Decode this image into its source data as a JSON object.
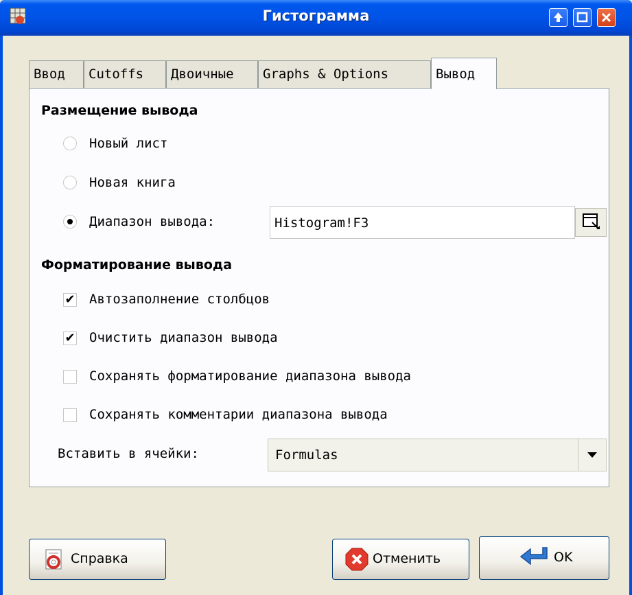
{
  "window": {
    "title": "Гистограмма"
  },
  "tabs": [
    {
      "label": "Ввод"
    },
    {
      "label": "Cutoffs"
    },
    {
      "label": "Двоичные"
    },
    {
      "label": "Graphs & Options"
    },
    {
      "label": "Вывод"
    }
  ],
  "output_location": {
    "heading": "Размещение вывода",
    "new_sheet": "Новый лист",
    "new_workbook": "Новая книга",
    "output_range": "Диапазон вывода:",
    "output_range_value": "Histogram!F3"
  },
  "output_format": {
    "heading": "Форматирование вывода",
    "autofit_columns": {
      "label": "Автозаполнение столбцов",
      "checked": true
    },
    "clear_range": {
      "label": "Очистить диапазон вывода",
      "checked": true
    },
    "retain_formatting": {
      "label": "Сохранять форматирование диапазона вывода",
      "checked": false
    },
    "retain_comments": {
      "label": "Сохранять комментарии диапазона вывода",
      "checked": false
    }
  },
  "paste_into": {
    "label": "Вставить в ячейки:",
    "value": "Formulas"
  },
  "buttons": {
    "help": "Справка",
    "cancel": "Отменить",
    "ok": "OK"
  },
  "colors": {
    "titlebar": "#0053e6",
    "background": "#ece9d8",
    "panel": "#fcfcfe",
    "cancel_icon": "#e23a2c",
    "ok_icon": "#2f78d2"
  },
  "icons": {
    "app": "spreadsheet-icon",
    "titlebar": [
      "maximize-icon",
      "restore-icon",
      "close-icon"
    ],
    "range_picker": "range-picker-icon",
    "dropdown": "chevron-down-icon",
    "help": "help-lifebuoy-icon",
    "cancel": "cancel-x-icon",
    "ok": "ok-enter-arrow-icon"
  }
}
